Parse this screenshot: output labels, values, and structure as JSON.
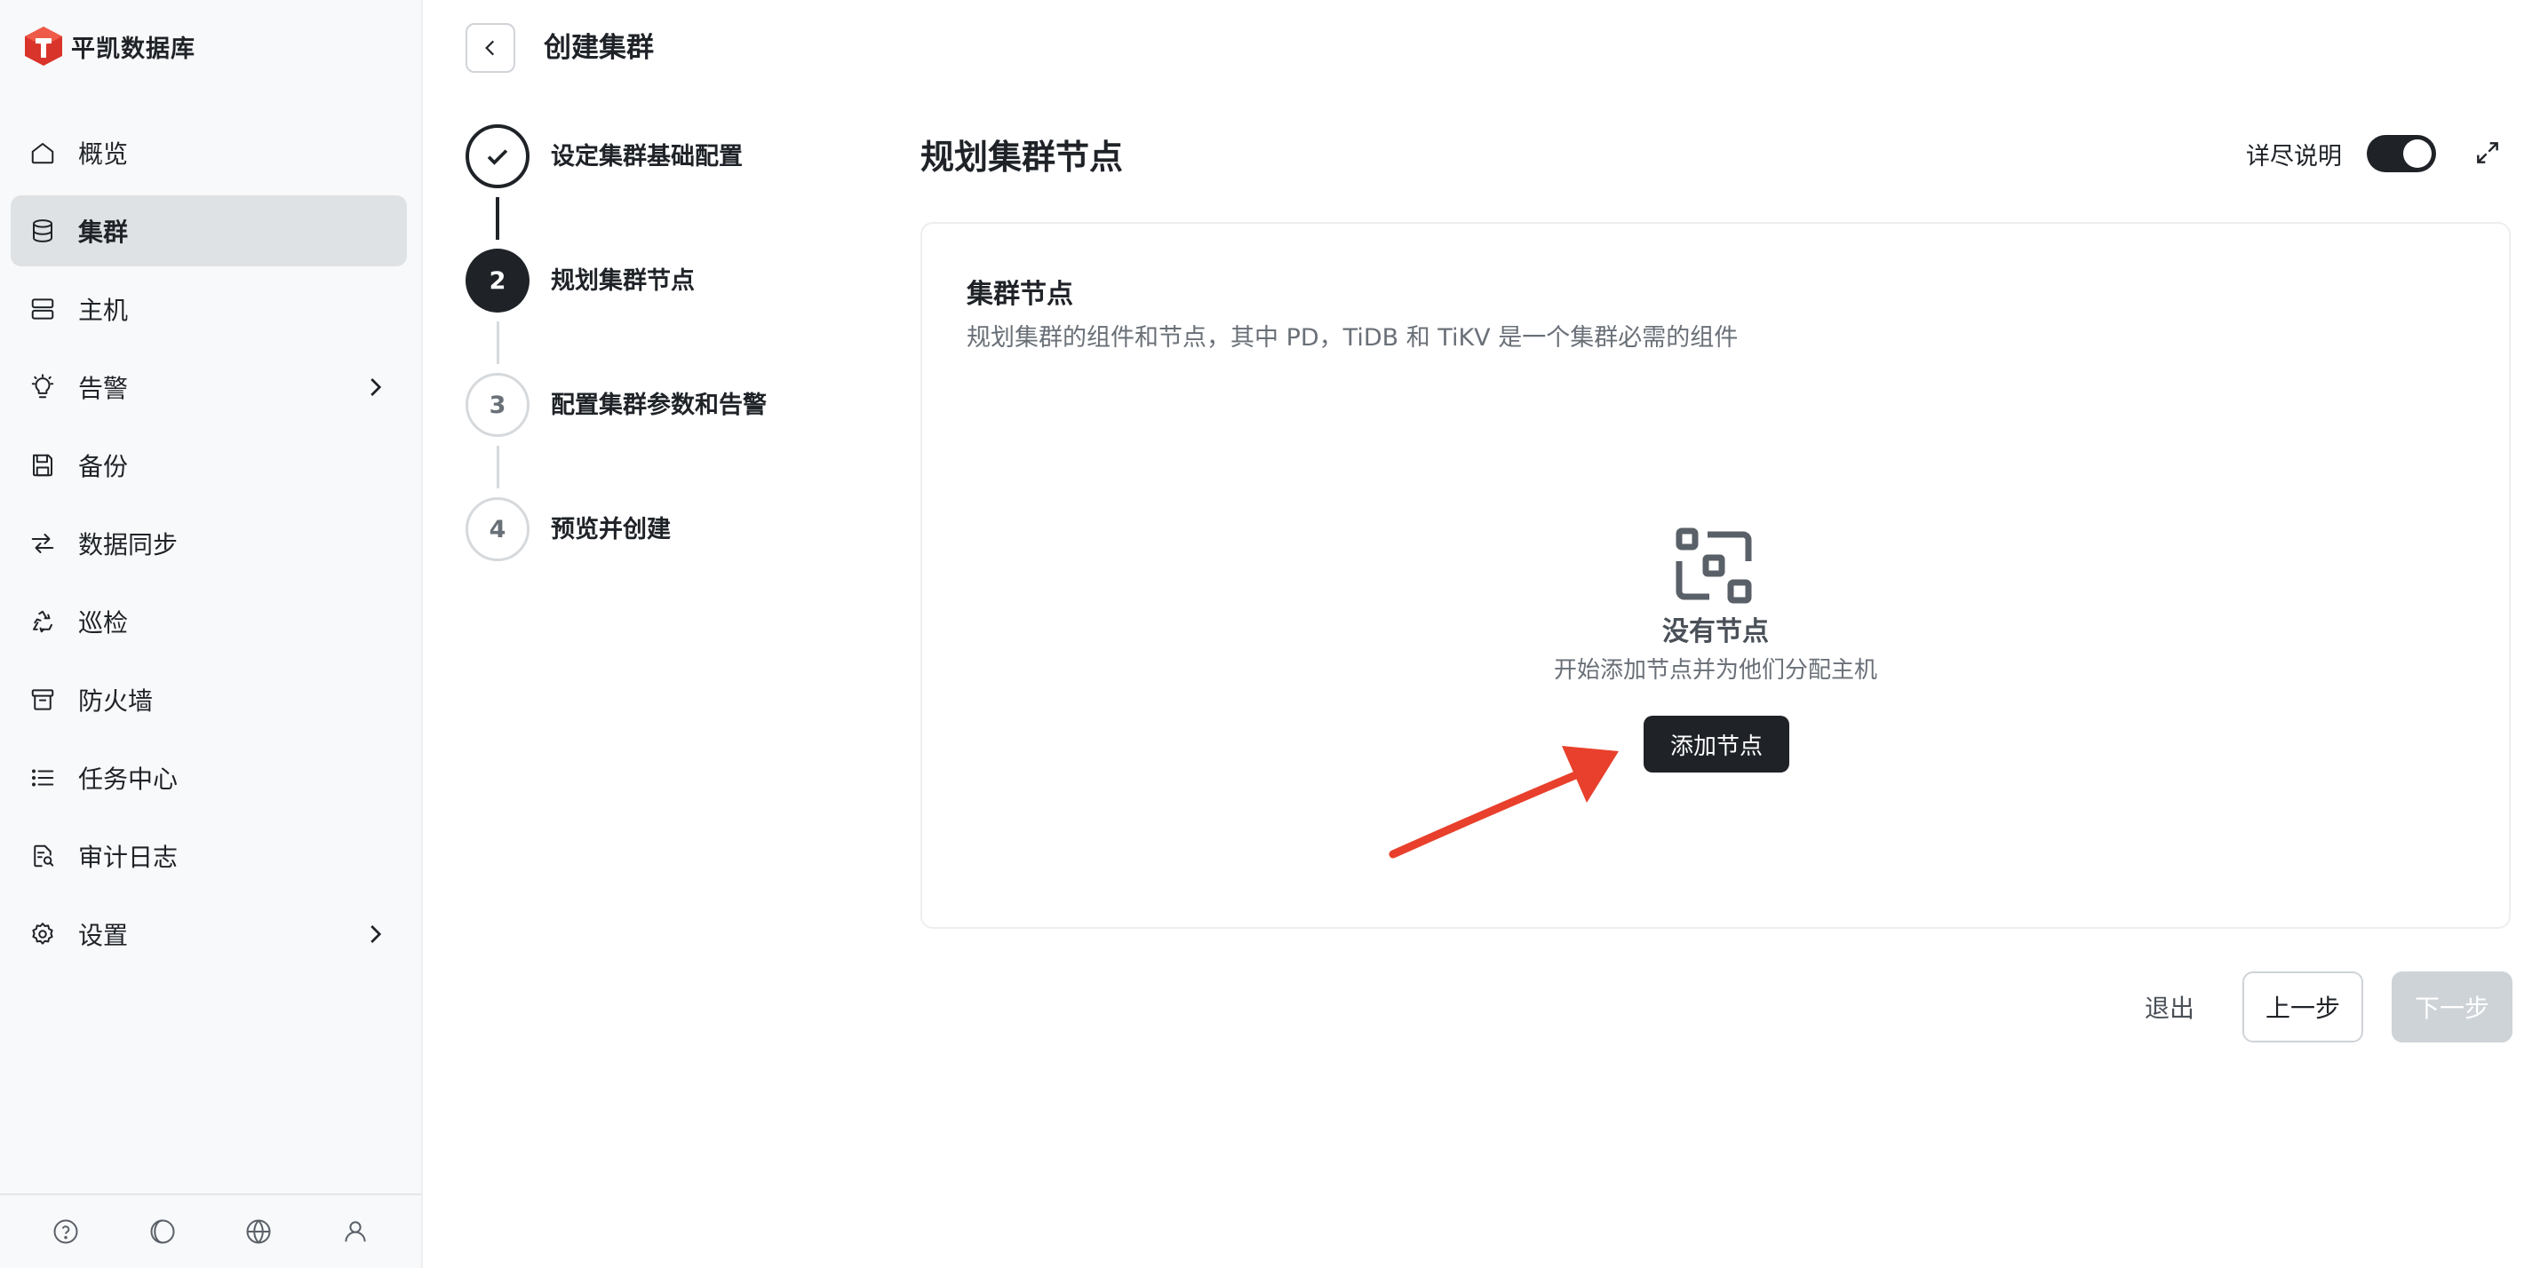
{
  "app": {
    "name": "平凯数据库"
  },
  "sidebar": {
    "items": [
      {
        "label": "概览",
        "icon": "home-icon"
      },
      {
        "label": "集群",
        "icon": "database-icon",
        "active": true
      },
      {
        "label": "主机",
        "icon": "server-icon"
      },
      {
        "label": "告警",
        "icon": "bulb-icon",
        "has_submenu": true
      },
      {
        "label": "备份",
        "icon": "save-icon"
      },
      {
        "label": "数据同步",
        "icon": "sync-icon"
      },
      {
        "label": "巡检",
        "icon": "recycle-icon"
      },
      {
        "label": "防火墙",
        "icon": "archive-icon"
      },
      {
        "label": "任务中心",
        "icon": "list-icon"
      },
      {
        "label": "审计日志",
        "icon": "file-search-icon"
      },
      {
        "label": "设置",
        "icon": "gear-icon",
        "has_submenu": true
      }
    ],
    "footer_icons": [
      "help-icon",
      "theme-icon",
      "globe-icon",
      "user-icon"
    ]
  },
  "header": {
    "title": "创建集群"
  },
  "steps": [
    {
      "number": "1",
      "label": "设定集群基础配置",
      "status": "done"
    },
    {
      "number": "2",
      "label": "规划集群节点",
      "status": "current"
    },
    {
      "number": "3",
      "label": "配置集群参数和告警",
      "status": "pending"
    },
    {
      "number": "4",
      "label": "预览并创建",
      "status": "pending"
    }
  ],
  "main": {
    "title": "规划集群节点",
    "toggle_label": "详尽说明",
    "toggle_on": true,
    "card": {
      "title": "集群节点",
      "description": "规划集群的组件和节点，其中 PD，TiDB 和 TiKV 是一个集群必需的组件",
      "empty_title": "没有节点",
      "empty_description": "开始添加节点并为他们分配主机",
      "add_button": "添加节点"
    }
  },
  "footer": {
    "exit": "退出",
    "prev": "上一步",
    "next": "下一步"
  },
  "colors": {
    "primary": "#1f2328",
    "annotation": "#e8402c",
    "disabled": "#ced3d8"
  }
}
